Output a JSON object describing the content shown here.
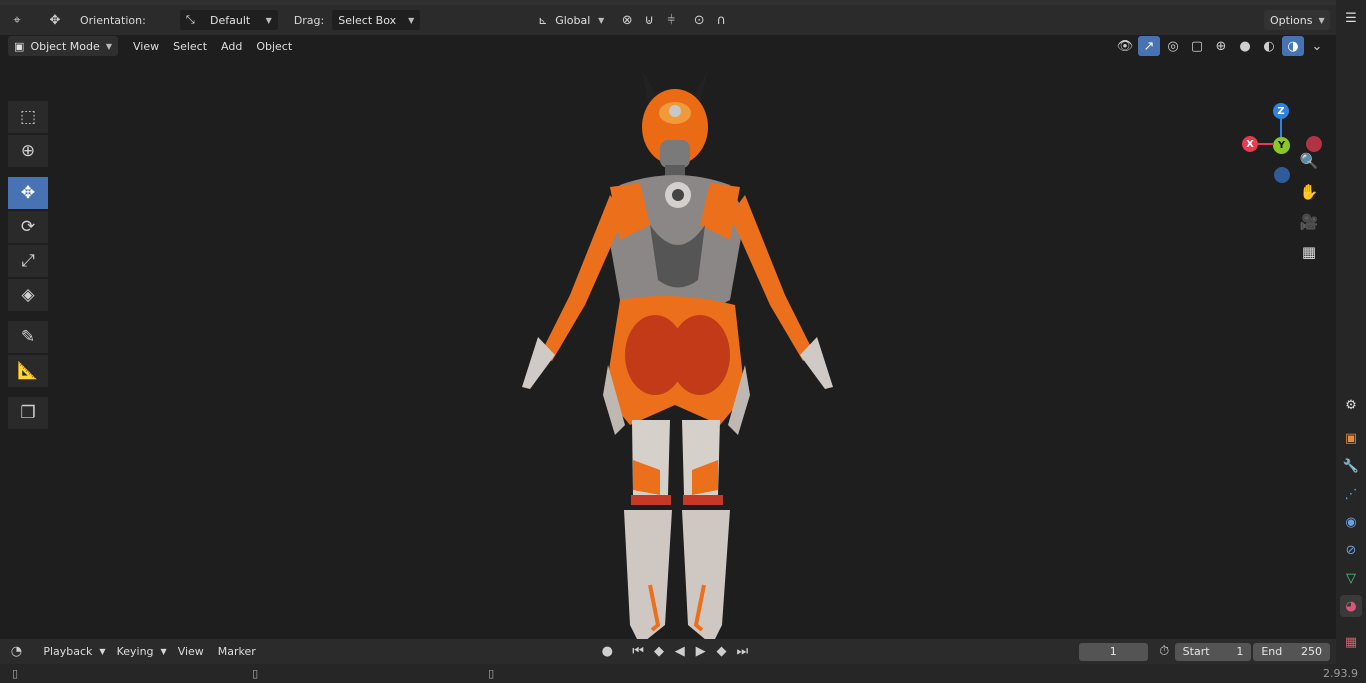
{
  "top_header": {
    "orientation_label": "Orientation:",
    "orientation_value": "Default",
    "drag_label": "Drag:",
    "drag_value": "Select Box",
    "transform_space": "Global",
    "options_label": "Options"
  },
  "viewport_header": {
    "mode": "Object Mode",
    "menus": [
      "View",
      "Select",
      "Add",
      "Object"
    ]
  },
  "gizmo": {
    "z_label": "Z",
    "y_label": "Y",
    "x_label": "X",
    "colors": {
      "x": "#e8394e",
      "y": "#8ac925",
      "z": "#2f83e0"
    }
  },
  "timeline": {
    "menus": [
      "Playback",
      "Keying",
      "View",
      "Marker"
    ],
    "current_frame": "1",
    "start_label": "Start",
    "start_value": "1",
    "end_label": "End",
    "end_value": "250"
  },
  "status": {
    "version": "2.93.9"
  },
  "accent": "#4772b3"
}
